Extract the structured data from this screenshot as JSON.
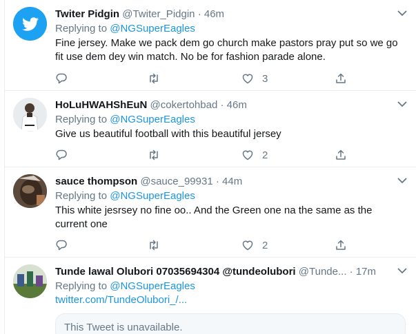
{
  "tweets": [
    {
      "name": "Twiter Pidgin",
      "handle": "@Twiter_Pidgin",
      "dot": "·",
      "time": "46m",
      "replying_prefix": "Replying to",
      "replying_to": "@NGSuperEagles",
      "text": "Fine jersey.  Make we pack dem go church make pastors pray put so we go fit use dem dey win match.  No be for fashion parade alone.",
      "likes": "3",
      "avatar_icon": "twitter-bird-icon"
    },
    {
      "name": "HoLuHWAHShEuN",
      "handle": "@cokertohbad",
      "dot": "·",
      "time": "46m",
      "replying_prefix": "Replying to",
      "replying_to": "@NGSuperEagles",
      "text": "Give us beautiful football with this beautiful jersey",
      "likes": "2"
    },
    {
      "name": "sauce thompson",
      "handle": "@sauce_99931",
      "dot": "·",
      "time": "44m",
      "replying_prefix": "Replying to",
      "replying_to": "@NGSuperEagles",
      "text": "This white jesrsey no fine oo.. And the Green one na the same as the current one",
      "likes": "2"
    },
    {
      "name": "Tunde lawal Olubori 07035694304 @tundeolubori",
      "handle": "@Tunde...",
      "dot": "·",
      "time": "17m",
      "replying_prefix": "Replying to",
      "replying_to": "@NGSuperEagles",
      "link": "twitter.com/TundeOlubori_/...",
      "unavailable": "This Tweet is unavailable."
    }
  ],
  "colors": {
    "accent": "#1b95e0",
    "twitter_blue": "#1da1f2",
    "secondary_text": "#657786",
    "border": "#e6ecf0"
  }
}
